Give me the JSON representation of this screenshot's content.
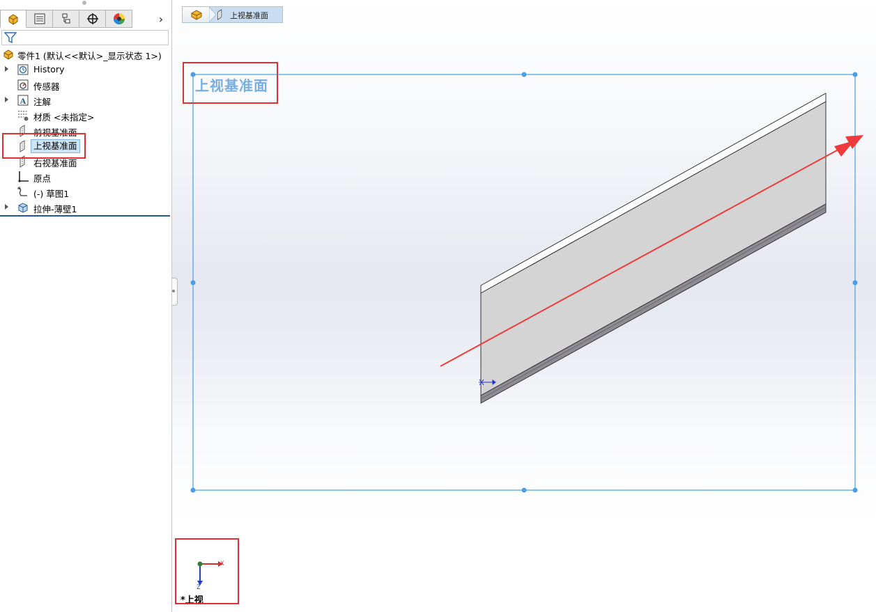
{
  "feature_manager": {
    "tabs": [
      {
        "name": "featuremanager-tab",
        "icon": "part-icon"
      },
      {
        "name": "propertymanager-tab",
        "icon": "list-icon"
      },
      {
        "name": "configurationmanager-tab",
        "icon": "config-icon"
      },
      {
        "name": "dimxpert-tab",
        "icon": "crosshair-icon"
      },
      {
        "name": "displaymanager-tab",
        "icon": "color-wheel-icon"
      }
    ],
    "more_glyph": "›",
    "tree": {
      "root": "零件1  (默认<<默认>_显示状态 1>)",
      "items": [
        {
          "label": "History",
          "icon": "history-icon",
          "expandable": true
        },
        {
          "label": "传感器",
          "icon": "sensor-icon",
          "expandable": false
        },
        {
          "label": "注解",
          "icon": "annotation-icon",
          "expandable": true
        },
        {
          "label": "材质 <未指定>",
          "icon": "material-icon",
          "expandable": false
        },
        {
          "label": "前视基准面",
          "icon": "plane-icon",
          "expandable": false
        },
        {
          "label": "上视基准面",
          "icon": "plane-icon",
          "expandable": false,
          "selected": true
        },
        {
          "label": "右视基准面",
          "icon": "plane-icon",
          "expandable": false
        },
        {
          "label": "原点",
          "icon": "origin-icon",
          "expandable": false
        },
        {
          "label": "(-) 草图1",
          "icon": "sketch-icon",
          "expandable": false
        },
        {
          "label": "拉伸-薄壁1",
          "icon": "extrude-icon",
          "expandable": true
        }
      ]
    }
  },
  "breadcrumb": {
    "current": "上视基准面"
  },
  "viewport": {
    "plane_label": "上视基准面",
    "triad": {
      "x_label": "X",
      "z_label": "Z",
      "view_name": "*上视"
    }
  },
  "colors": {
    "highlight": "#e0302f",
    "plane_outline": "#4a9ee8",
    "plane_label": "#78aee0",
    "arrow": "#ef3b3b",
    "selection_fill": "#cde3f6"
  }
}
